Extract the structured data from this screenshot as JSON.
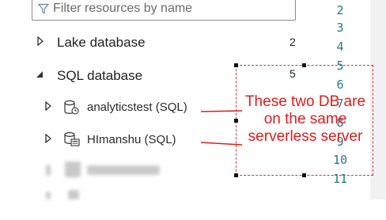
{
  "filter": {
    "placeholder": "Filter resources by name"
  },
  "tree": {
    "lake": {
      "label": "Lake database",
      "count": "2"
    },
    "sql": {
      "label": "SQL database",
      "count": "5"
    },
    "items": [
      {
        "label": "analyticstest (SQL)"
      },
      {
        "label": "HImanshu (SQL)"
      }
    ]
  },
  "editor": {
    "line_numbers": [
      "2",
      "3",
      "4",
      "5",
      "6",
      "7",
      "8",
      "9",
      "10",
      "11"
    ]
  },
  "annotation": {
    "text": "These two DB are on the same serverless server",
    "color": "#e01b1b"
  }
}
